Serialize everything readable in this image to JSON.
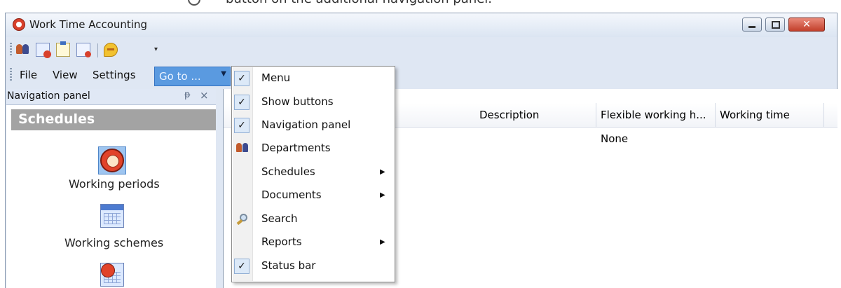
{
  "caption": "button on the additional navigation panel.",
  "window": {
    "title": "Work Time Accounting",
    "close_glyph": "✕"
  },
  "toolbar": {
    "icons": [
      "departments-icon",
      "schedules-icon",
      "documents-icon",
      "reports-icon",
      "feedback-icon"
    ],
    "overflow_glyph": "▾"
  },
  "menubar": {
    "file": "File",
    "view": "View",
    "settings": "Settings",
    "goto": "Go to ...",
    "goto_arrow": "▼"
  },
  "nav_panel": {
    "title": "Navigation panel",
    "pin_glyph": "ᵽ",
    "close_glyph": "×",
    "group": "Schedules",
    "items": [
      {
        "label": "Working periods",
        "icon": "clock-icon"
      },
      {
        "label": "Working schemes",
        "icon": "calendar-icon"
      },
      {
        "label": "",
        "icon": "calendar-clock-icon"
      }
    ]
  },
  "grid": {
    "columns": [
      "Description",
      "Flexible working h...",
      "Working time"
    ],
    "rows": [
      {
        "description": "",
        "flexible": "None",
        "working_time": ""
      }
    ]
  },
  "goto_menu": {
    "items": [
      {
        "label": "Menu",
        "checked": true,
        "submenu": false
      },
      {
        "label": "Show buttons",
        "checked": true,
        "submenu": false
      },
      {
        "label": "Navigation panel",
        "checked": true,
        "submenu": false
      },
      {
        "label": "Departments",
        "checked": false,
        "submenu": false,
        "icon": "departments-icon"
      },
      {
        "label": "Schedules",
        "checked": false,
        "submenu": true
      },
      {
        "label": "Documents",
        "checked": false,
        "submenu": true
      },
      {
        "label": "Search",
        "checked": false,
        "submenu": false,
        "icon": "search-icon"
      },
      {
        "label": "Reports",
        "checked": false,
        "submenu": true
      },
      {
        "label": "Status bar",
        "checked": true,
        "submenu": false
      }
    ],
    "check_glyph": "✓",
    "submenu_glyph": "▶"
  },
  "colors": {
    "accent": "#5a9ae0",
    "chrome": "#dfe7f3",
    "group_header": "#a3a3a3",
    "close_button": "#c2402b"
  }
}
